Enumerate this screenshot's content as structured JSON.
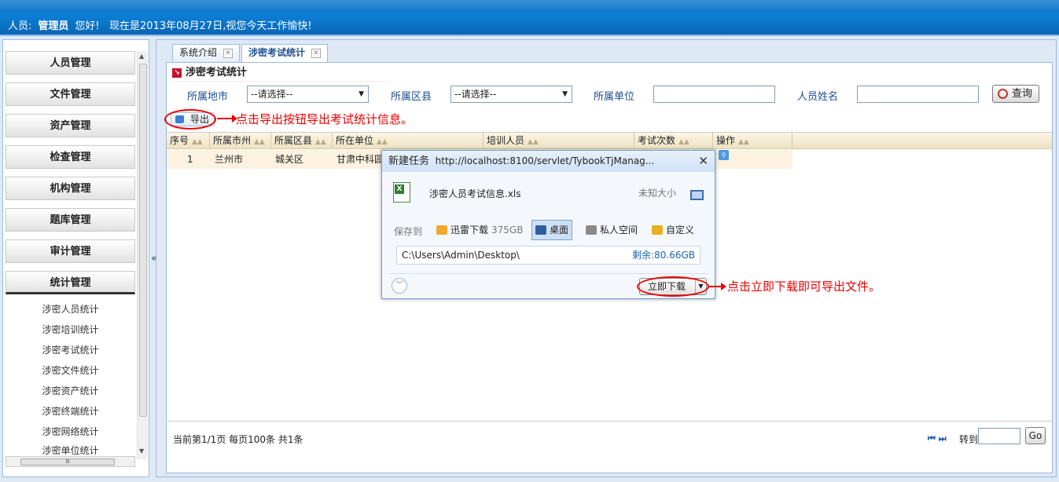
{
  "header": {
    "user_label": "人员:",
    "user_name": "管理员",
    "greeting": "您好!",
    "date_text": "现在是2013年08月27日,视您今天工作愉快!"
  },
  "sidebar": {
    "menus": [
      {
        "label": "人员管理"
      },
      {
        "label": "文件管理"
      },
      {
        "label": "资产管理"
      },
      {
        "label": "检查管理"
      },
      {
        "label": "机构管理"
      },
      {
        "label": "题库管理"
      },
      {
        "label": "审计管理"
      },
      {
        "label": "统计管理"
      }
    ],
    "sub_items": [
      {
        "label": "涉密人员统计"
      },
      {
        "label": "涉密培训统计"
      },
      {
        "label": "涉密考试统计"
      },
      {
        "label": "涉密文件统计"
      },
      {
        "label": "涉密资产统计"
      },
      {
        "label": "涉密终端统计"
      },
      {
        "label": "涉密网络统计"
      },
      {
        "label": "涉密单位统计"
      }
    ],
    "hscroll_glyph": "Ⅲ",
    "collapse_glyph": "«"
  },
  "tabs": [
    {
      "label": "系统介绍"
    },
    {
      "label": "涉密考试统计"
    }
  ],
  "panel": {
    "title": "涉密考试统计",
    "filters": {
      "city_label": "所属地市",
      "city_value": "--请选择--",
      "district_label": "所属区县",
      "district_value": "--请选择--",
      "unit_label": "所属单位",
      "unit_value": "",
      "name_label": "人员姓名",
      "name_value": ""
    },
    "query_label": "查询",
    "export_label": "导出",
    "export_annotation": "点击导出按钮导出考试统计信息。"
  },
  "grid": {
    "columns": [
      "序号",
      "所属市州",
      "所属区县",
      "所在单位",
      "培训人员",
      "考试次数",
      "操作"
    ],
    "rows": [
      {
        "index": "1",
        "city": "兰州市",
        "district": "城关区",
        "unit": "甘肃中科园"
      }
    ]
  },
  "pager": {
    "info": "当前第1/1页 每页100条 共1条",
    "nav": "⏮ ⏭",
    "goto_label": "转到",
    "go_label": "Go"
  },
  "dialog": {
    "title": "新建任务",
    "url": "http://localhost:8100/servlet/TybookTjManag...",
    "file_name": "涉密人员考试信息.xls",
    "file_size": "未知大小",
    "save_to_label": "保存到",
    "options": [
      {
        "label": "迅雷下载",
        "extra": "375GB",
        "icon_color": "#f0a830"
      },
      {
        "label": "桌面",
        "extra": "",
        "icon_color": "#2f5f9e"
      },
      {
        "label": "私人空间",
        "extra": "",
        "icon_color": "#8a8a8a"
      },
      {
        "label": "自定义",
        "extra": "",
        "icon_color": "#e8b020"
      }
    ],
    "path": "C:\\Users\\Admin\\Desktop\\",
    "free_space": "剩余:80.66GB",
    "download_label": "立即下载",
    "download_annotation": "点击立即下载即可导出文件。"
  }
}
